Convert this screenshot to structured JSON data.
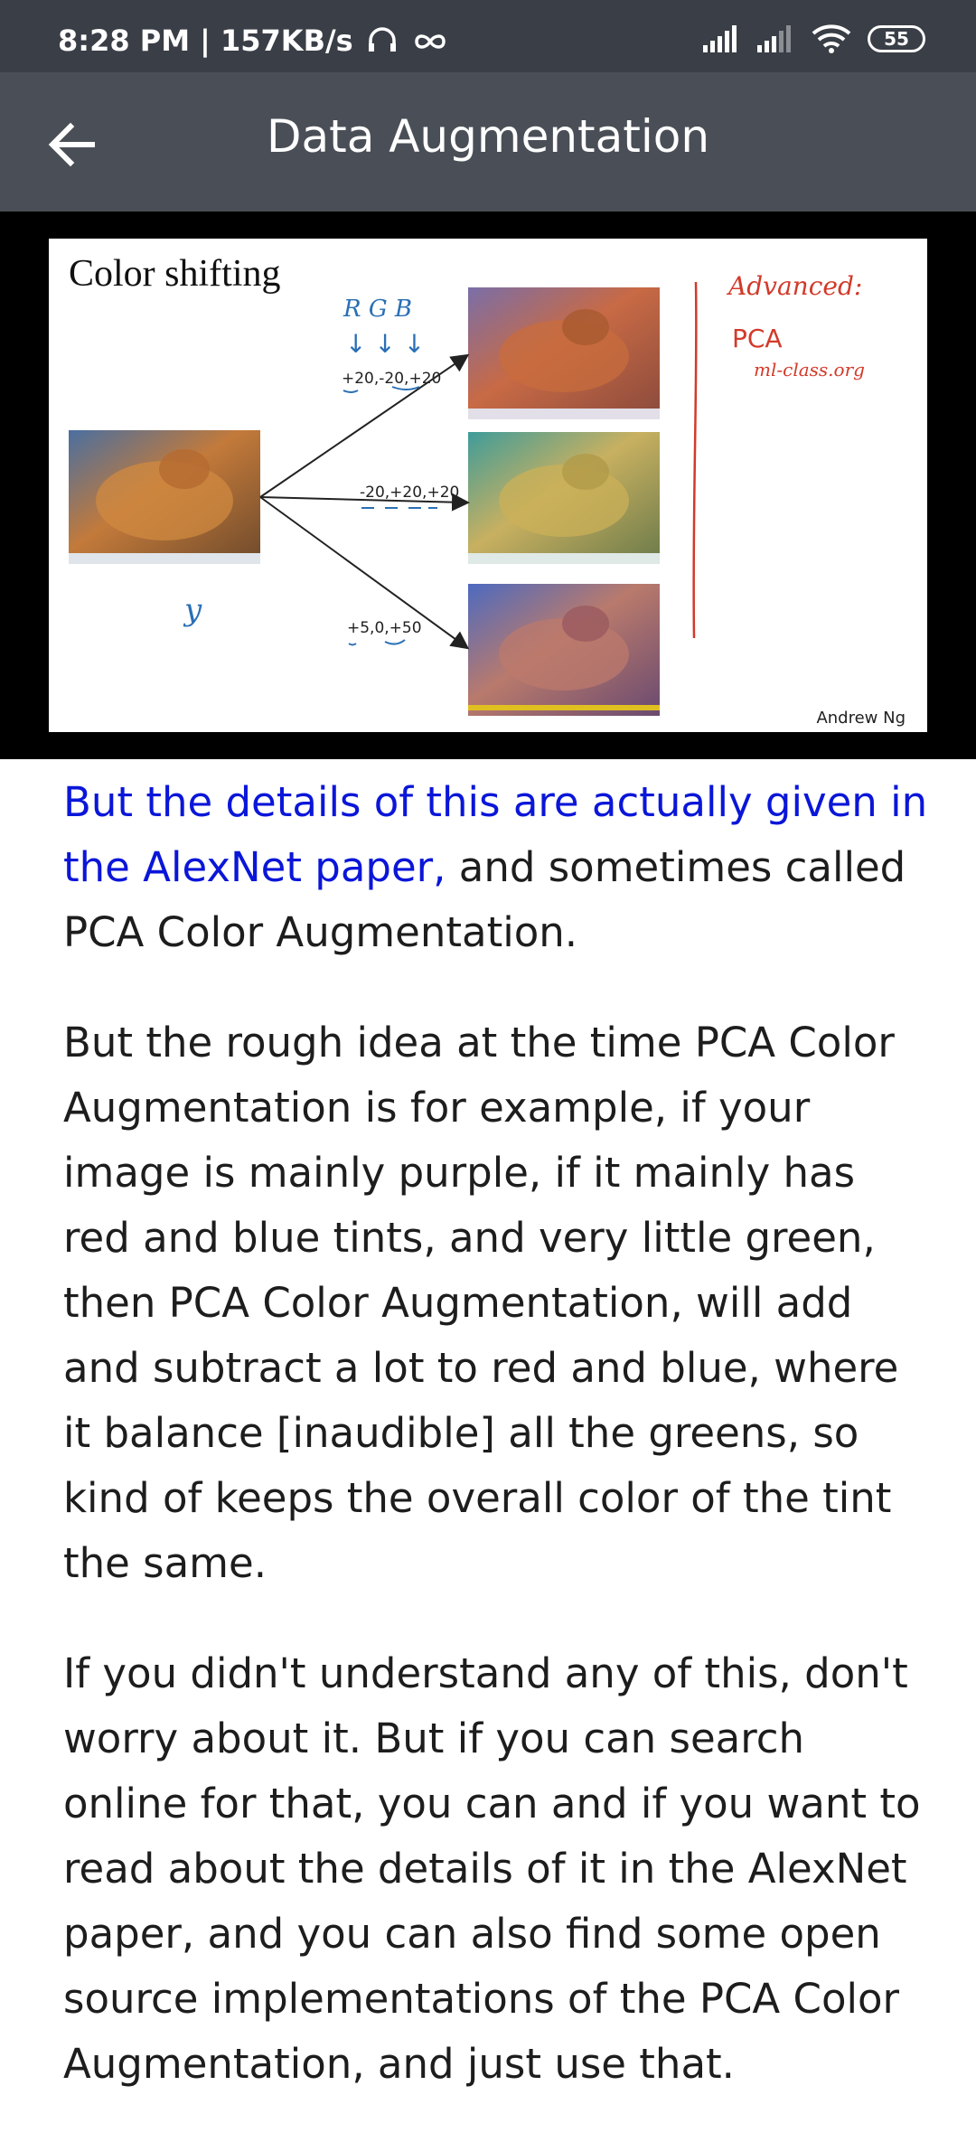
{
  "status_bar": {
    "time": "8:28 PM | 157KB/s",
    "battery": "55"
  },
  "header": {
    "title": "Data Augmentation"
  },
  "slide": {
    "heading": "Color shifting",
    "rgb_label": "R G B",
    "arrows_label": "↓ ↓ ↓",
    "shift_1": "+20,-20,+20",
    "shift_2": "-20,+20,+20",
    "shift_3": "+5,0,+50",
    "y_label": "y",
    "note_1": "Advanced:",
    "note_2": "PCA",
    "note_3": "ml-class.org",
    "credit": "Andrew Ng"
  },
  "transcript": {
    "p1_highlight": "But the details of this are actually given in the AlexNet paper,",
    "p1_rest": " and sometimes called PCA Color Augmentation.",
    "p2": "But the rough idea at the time PCA Color Augmentation is for example, if your image is mainly purple, if it mainly has red and blue tints, and very little green, then PCA Color Augmentation, will add and subtract a lot to red and blue, where it balance [inaudible] all the greens, so kind of keeps the overall color of the tint the same.",
    "p3": "If you didn't understand any of this, don't worry about it. But if you can search online for that, you can and if you want to read about the details of it in the AlexNet paper, and you can also find some open source implementations of the PCA Color Augmentation, and just use that."
  },
  "colors": {
    "status_bg": "#3a3e46",
    "appbar_bg": "#4a4f57",
    "highlight": "#0a16d8",
    "ink_blue": "#2a6fb5",
    "ink_red": "#d23a2a"
  }
}
